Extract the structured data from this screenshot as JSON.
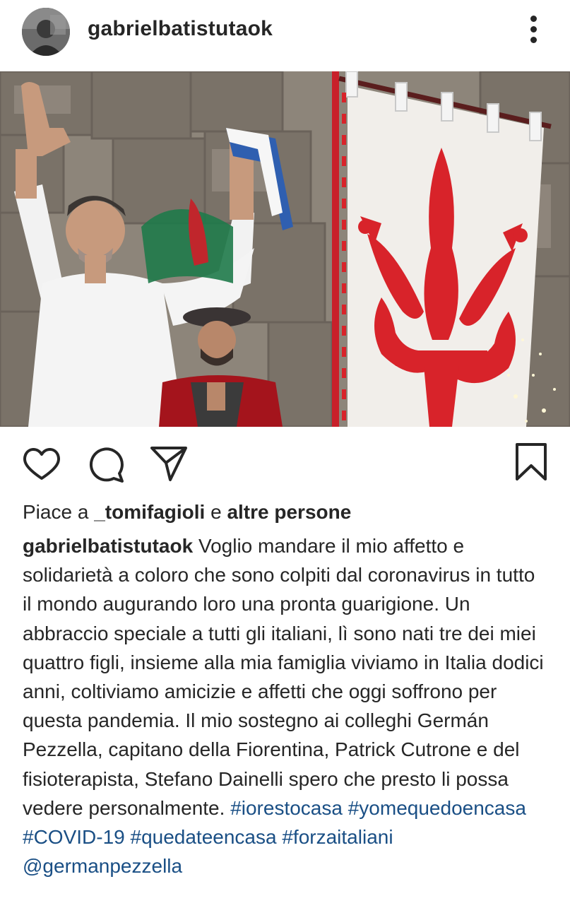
{
  "post": {
    "username": "gabrielbatistutaok"
  },
  "icons": {
    "more": "more-vertical-icon",
    "like": "heart-icon",
    "comment": "comment-icon",
    "share": "send-icon",
    "save": "bookmark-icon"
  },
  "likes": {
    "prefix": "Piace a",
    "user": "_tomifagioli",
    "joiner": "e",
    "others": "altre persone"
  },
  "caption": {
    "username": "gabrielbatistutaok",
    "text": "Voglio mandare il mio affetto e solidarietà a coloro che sono colpiti dal coronavirus in tutto il mondo augurando loro una pronta guarigione. Un abbraccio speciale a tutti gli italiani, lì sono nati tre dei miei quattro figli, insieme alla mia famiglia viviamo in Italia dodici anni, coltiviamo amicizie e affetti che oggi soffrono per questa pandemia. Il mio sostegno ai colleghi Germán Pezzella, capitano della Fiorentina, Patrick Cutrone e del fisioterapista, Stefano Dainelli spero che presto li possa vedere personalmente.",
    "tags": [
      "#iorestocasa",
      "#yomequedoencasa",
      "#COVID-19",
      "#quedateencasa",
      "#forzaitaliani",
      "@germanpezzella"
    ]
  },
  "colors": {
    "text": "#262626",
    "link": "#1a4f85",
    "flag_red": "#d8232a"
  }
}
